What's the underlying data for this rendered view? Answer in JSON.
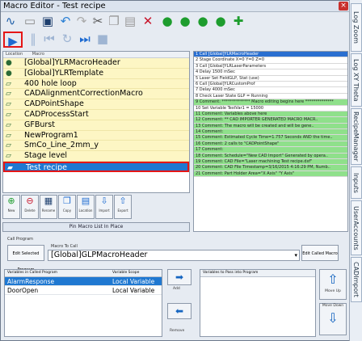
{
  "window": {
    "title": "Macro Editor - Test recipe",
    "close_label": "×"
  },
  "right_tabs": [
    "Log Zoom",
    "Log XY Theta",
    "RecipeManager",
    "Inputs",
    "UserAccounts",
    "CADImport"
  ],
  "toolbar": {
    "icons": [
      "wave-icon",
      "new-icon",
      "save-icon",
      "undo-icon",
      "redo-icon",
      "cut-icon",
      "copy-icon",
      "paste-icon",
      "delete-icon",
      "circle-add-icon",
      "circle-up-icon",
      "circle-down-icon",
      "circle-insert-icon",
      "plus-icon"
    ],
    "play_icons": [
      "play-icon",
      "step-icon",
      "rewind-icon",
      "reload-icon",
      "step-next-icon",
      "stop-icon"
    ]
  },
  "macro_list": {
    "headers": [
      "Location",
      "Macro"
    ],
    "items": [
      {
        "label": "[Global]YLRMacroHeader",
        "icon": "global-icon"
      },
      {
        "label": "[Global]YLRTemplate",
        "icon": "global-icon"
      },
      {
        "label": "400 hole loop",
        "icon": "folder-icon"
      },
      {
        "label": "CADAlignmentCorrectionMacro",
        "icon": "folder-icon"
      },
      {
        "label": "CADPointShape",
        "icon": "folder-icon"
      },
      {
        "label": "CADProcessStart",
        "icon": "folder-icon"
      },
      {
        "label": "GFBurst",
        "icon": "folder-icon"
      },
      {
        "label": "NewProgram1",
        "icon": "folder-icon"
      },
      {
        "label": "SmCo_Line_2mm_y",
        "icon": "folder-icon"
      },
      {
        "label": "Stage level",
        "icon": "folder-icon"
      },
      {
        "label": "Test recipe",
        "icon": "folder-icon",
        "selected": true
      }
    ]
  },
  "steps": [
    {
      "text": "1  Call [Global]YLRMacroHeader",
      "style": "b"
    },
    {
      "text": "2  Stage Coordinate X=0 Y=0 Z=0",
      "style": ""
    },
    {
      "text": "3  Call [Global]YLRLaserParameters",
      "style": ""
    },
    {
      "text": "4  Delay 1500 mSec",
      "style": ""
    },
    {
      "text": "5  Laser Set FieldGLP, Stat (use)",
      "style": ""
    },
    {
      "text": "6  Call [Global]YLRCustomProf",
      "style": ""
    },
    {
      "text": "7  Delay 4000 mSec",
      "style": ""
    },
    {
      "text": "8  Check Laser State GLP = Running",
      "style": ""
    },
    {
      "text": "9  Comment: ************** Macro editing begins here **************",
      "style": "g"
    },
    {
      "text": "10 Set Variable TestVar1 = 15000",
      "style": ""
    },
    {
      "text": "11 Comment: Variables above here",
      "style": "g"
    },
    {
      "text": "12 Comment: ** CAD IMPORTER GENERATED MACRO MACR..",
      "style": "g"
    },
    {
      "text": "13 Comment: The macro will be created and will be gene..",
      "style": "g"
    },
    {
      "text": "14 Comment:",
      "style": "g"
    },
    {
      "text": "15 Comment: Estimated Cycle Time=1.757 Seconds AND the time..",
      "style": "g"
    },
    {
      "text": "16 Comment:      2 calls to \"CADPointShape\"",
      "style": "g"
    },
    {
      "text": "17 Comment:",
      "style": "g"
    },
    {
      "text": "18 Comment: Schedule=\"New CAD Import\" Generated by opera..",
      "style": "g"
    },
    {
      "text": "19 Comment: CAD File=\"Laser machining Test recipe.dxf\"",
      "style": "g"
    },
    {
      "text": "20 Comment: CAD File Timestamp=3/16/2015 4:16:29 PM, Numb..",
      "style": "g"
    },
    {
      "text": "21 Comment: Part Holder Area=\"X Axis\" \"Y Axis\"",
      "style": "g"
    }
  ],
  "list_buttons": [
    {
      "label": "New",
      "icon": "new-macro-icon"
    },
    {
      "label": "Delete",
      "icon": "delete-macro-icon"
    },
    {
      "label": "Rename",
      "icon": "rename-icon"
    },
    {
      "label": "Copy",
      "icon": "copy-macro-icon"
    },
    {
      "label": "Location",
      "icon": "location-icon"
    },
    {
      "label": "Import",
      "icon": "import-icon"
    },
    {
      "label": "Export",
      "icon": "export-icon"
    }
  ],
  "pin_button": "Pin Macro List In Place",
  "call_program": {
    "caption": "Call Program",
    "edit_selected": "Edit Selected Program",
    "macro_to_call_label": "Macro To Call",
    "selected_macro": "[Global]GLPMacroHeader",
    "edit_called": "Edit Called Macro"
  },
  "variables_table": {
    "headers": [
      "Variables in Called Program",
      "Variable Scope"
    ],
    "rows": [
      {
        "name": "AlarmResponse",
        "scope": "Local Variable",
        "selected": true
      },
      {
        "name": "DoorOpen",
        "scope": "Local Variable",
        "selected": false
      }
    ]
  },
  "mid_buttons": [
    {
      "label": "Add",
      "icon": "arrow-right-icon"
    },
    {
      "label": "",
      "icon": "arrow-left-icon"
    },
    {
      "label": "Remove",
      "icon": "arrow-left-icon"
    }
  ],
  "pass_table": {
    "header": "Variables to Pass into Program"
  },
  "move_buttons": [
    {
      "label": "Move Up",
      "icon": "arrow-up-icon"
    },
    {
      "label": "Move Down",
      "icon": "arrow-down-icon"
    }
  ]
}
